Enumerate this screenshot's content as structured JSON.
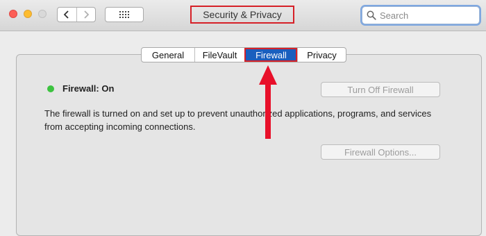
{
  "window": {
    "title": "Security & Privacy",
    "highlight_color": "#d62027"
  },
  "toolbar": {
    "back_icon": "chevron-left-icon",
    "forward_icon": "chevron-right-icon",
    "show_all_icon": "grid-icon"
  },
  "search": {
    "placeholder": "Search",
    "value": ""
  },
  "tabs": [
    {
      "label": "General",
      "selected": false
    },
    {
      "label": "FileVault",
      "selected": false
    },
    {
      "label": "Firewall",
      "selected": true
    },
    {
      "label": "Privacy",
      "selected": false
    }
  ],
  "firewall": {
    "status_label": "Firewall: On",
    "status_color": "#3dc340",
    "turn_off_label": "Turn Off Firewall",
    "description": "The firewall is turned on and set up to prevent unauthorized applications, programs, and services from accepting incoming connections.",
    "options_label": "Firewall Options..."
  },
  "annotation": {
    "arrow_color": "#e8102a"
  }
}
